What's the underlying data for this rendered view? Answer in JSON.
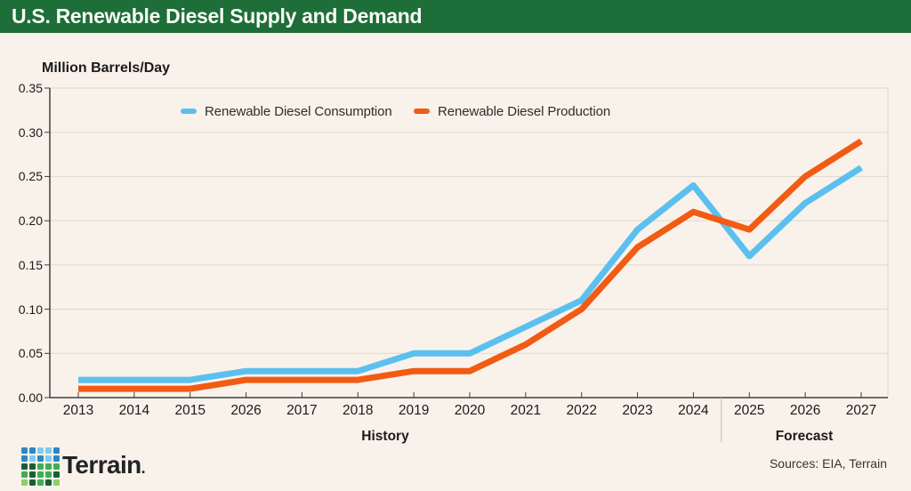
{
  "header": {
    "title": "U.S. Renewable Diesel Supply and Demand"
  },
  "chart": {
    "y_axis_title": "Million Barrels/Day",
    "sections": [
      {
        "label": "History"
      },
      {
        "label": "Forecast"
      }
    ]
  },
  "chart_data": {
    "type": "line",
    "title": "U.S. Renewable Diesel Supply and Demand",
    "ylabel": "Million Barrels/Day",
    "categories": [
      "2013",
      "2014",
      "2015",
      "2026",
      "2017",
      "2018",
      "2019",
      "2020",
      "2021",
      "2022",
      "2023",
      "2024",
      "2025",
      "2026",
      "2027"
    ],
    "y_tick_labels": [
      "0.00",
      "0.05",
      "0.10",
      "0.15",
      "0.20",
      "0.25",
      "0.30",
      "0.35"
    ],
    "ylim": [
      0,
      0.35
    ],
    "grid": true,
    "legend_position": "top",
    "series": [
      {
        "name": "Renewable Diesel Consumption",
        "color": "#5bc0ef",
        "values": [
          0.02,
          0.02,
          0.02,
          0.03,
          0.03,
          0.03,
          0.05,
          0.05,
          0.08,
          0.11,
          0.19,
          0.24,
          0.16,
          0.22,
          0.26
        ]
      },
      {
        "name": "Renewable Diesel Production",
        "color": "#f15b13",
        "values": [
          0.01,
          0.01,
          0.01,
          0.02,
          0.02,
          0.02,
          0.03,
          0.03,
          0.06,
          0.1,
          0.17,
          0.21,
          0.19,
          0.25,
          0.29
        ]
      }
    ],
    "divider_after_category": "2024"
  },
  "colors": {
    "header_bg": "#1d6e38",
    "page_bg": "#f8f2ea",
    "grid": "#ded7cd",
    "axis": "#3f3f3f",
    "divider": "#c9c3ba",
    "text": "#1b1b1b"
  },
  "footer": {
    "wordmark": "Terrain",
    "wordmark_dot": ".",
    "sources": "Sources: EIA, Terrain",
    "logo_palette": {
      "B1": "#2b87ca",
      "B2": "#7ecbf1",
      "G1": "#1e5c33",
      "G2": "#3fae4f",
      "G3": "#8ed061"
    },
    "logo_grid": [
      [
        "B1",
        "B1",
        "B2",
        "B2",
        "B1"
      ],
      [
        "B1",
        "B2",
        "B1",
        "B2",
        "B1"
      ],
      [
        "G1",
        "G1",
        "G2",
        "G2",
        "G2"
      ],
      [
        "G2",
        "G1",
        "G2",
        "G2",
        "G1"
      ],
      [
        "G3",
        "G1",
        "G2",
        "G1",
        "G3"
      ]
    ]
  }
}
